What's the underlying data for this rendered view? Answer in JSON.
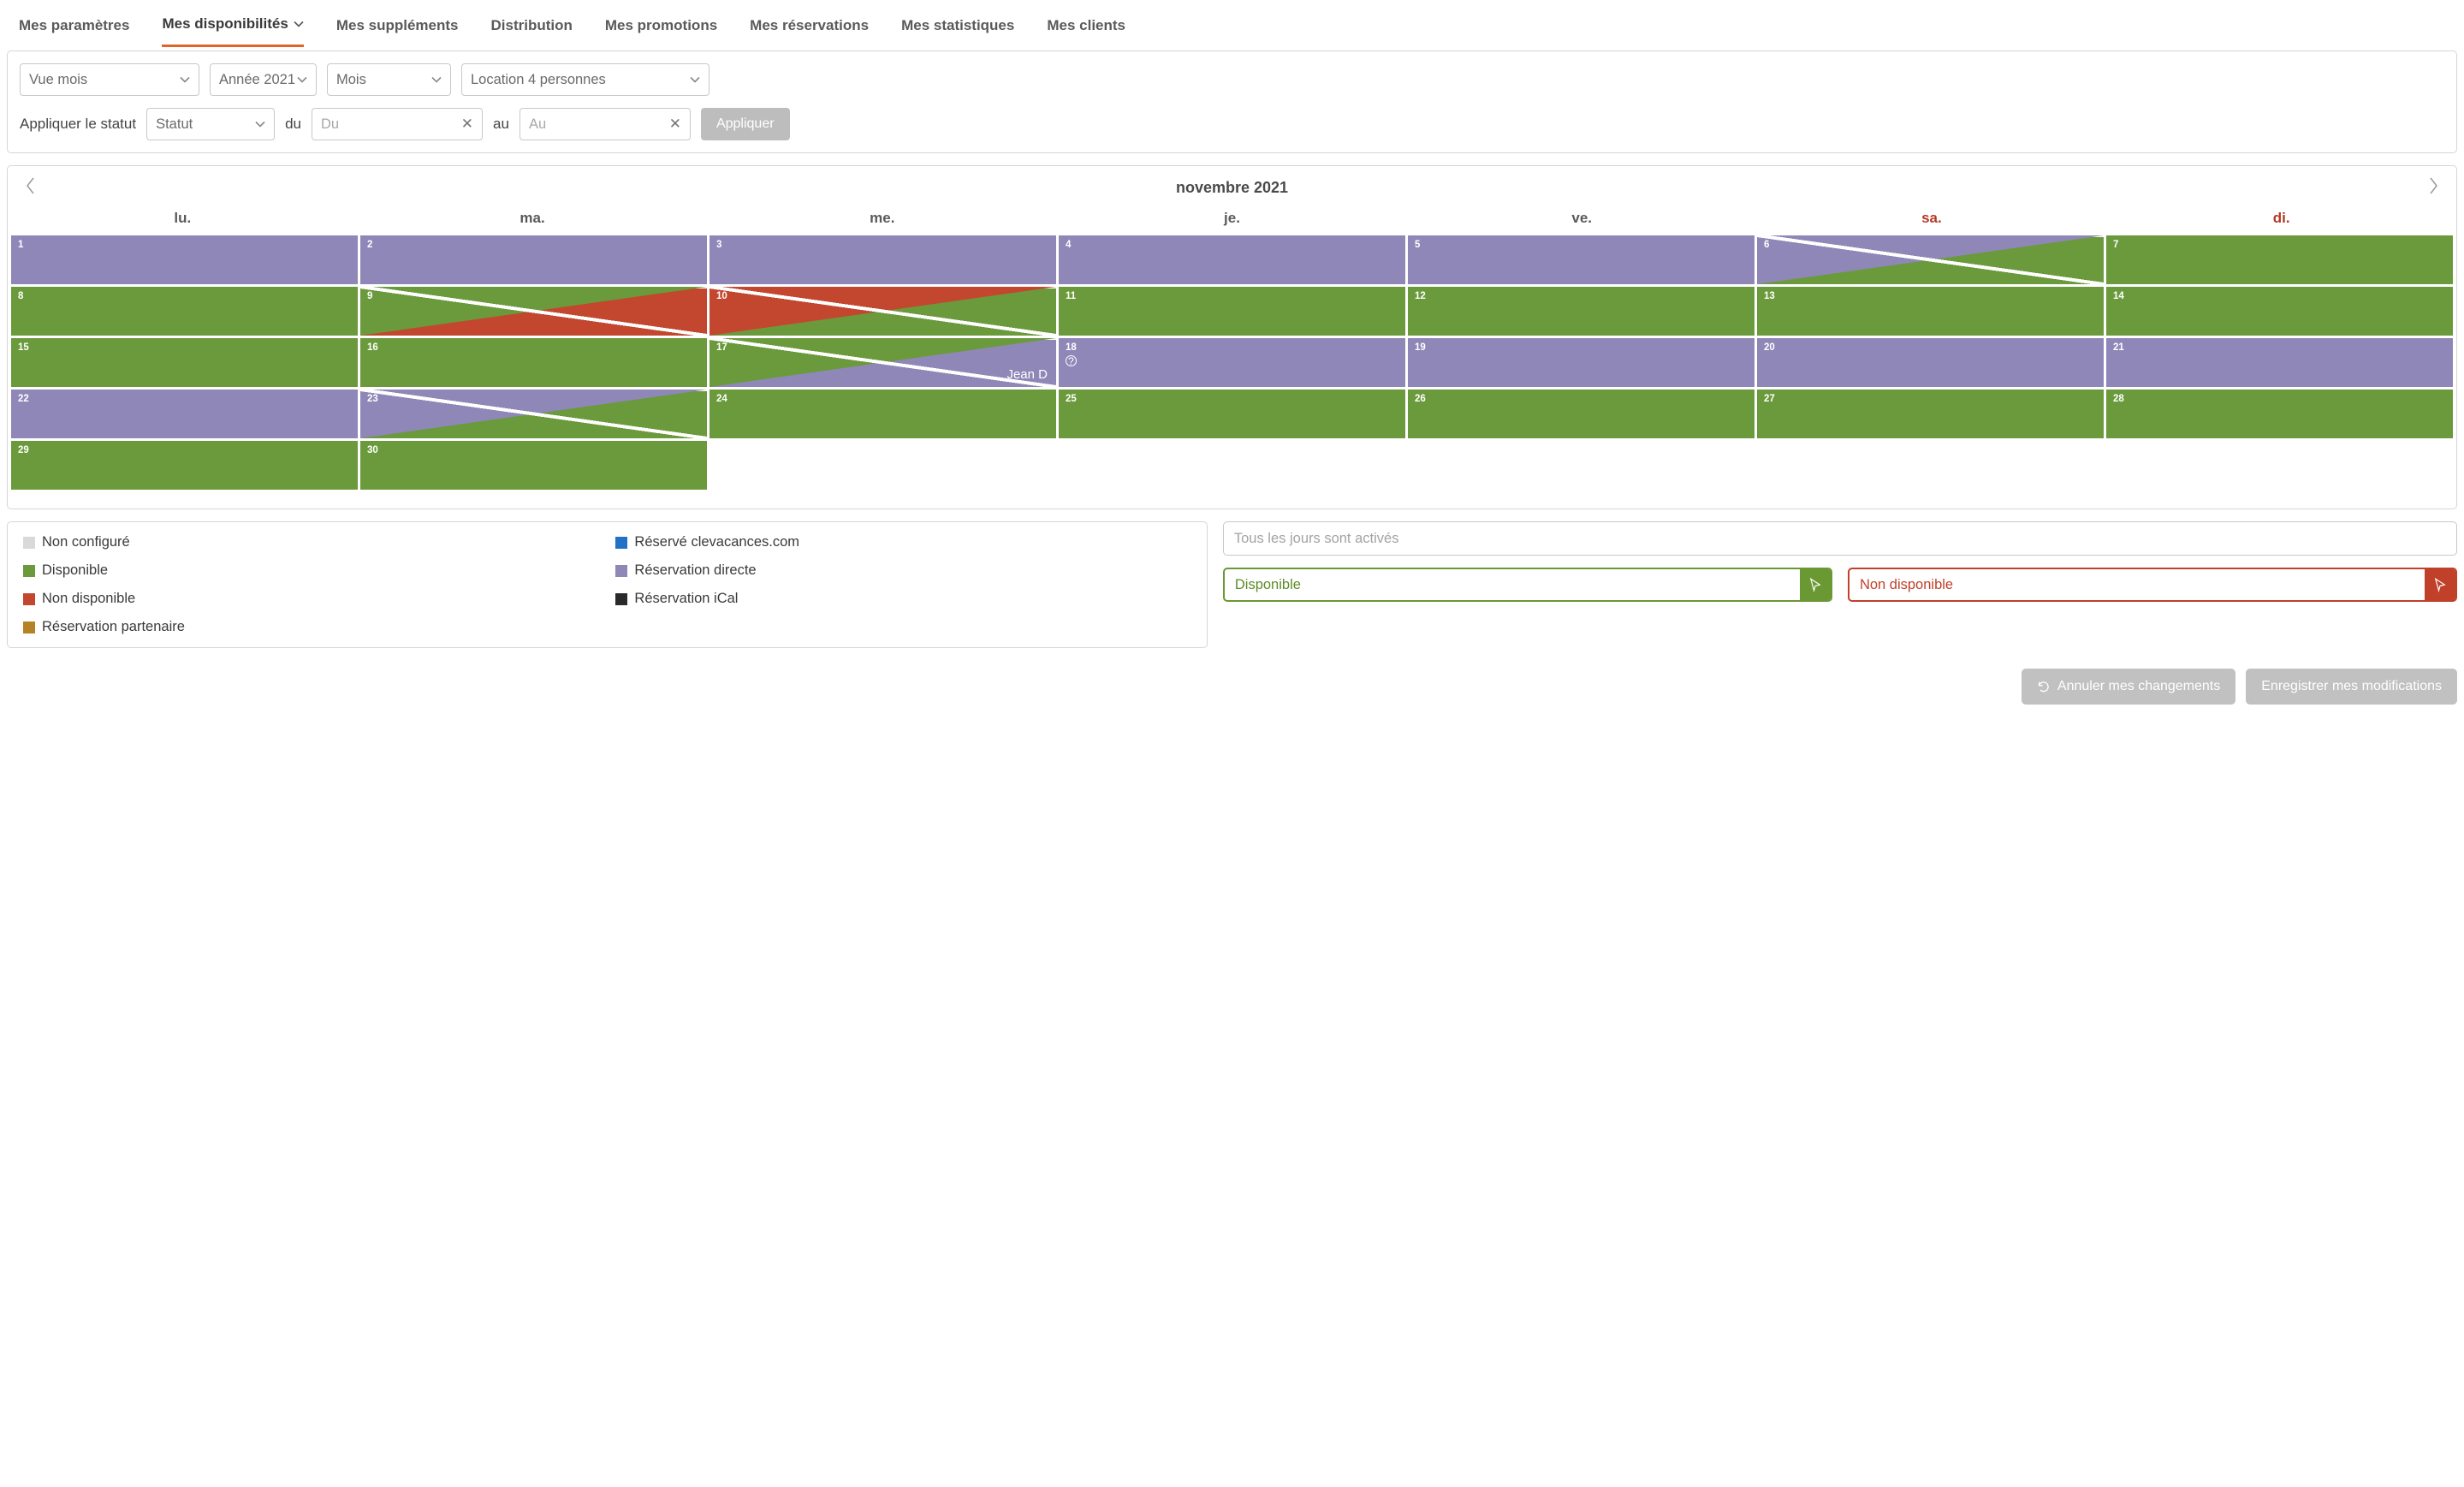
{
  "tabs": {
    "params": "Mes paramètres",
    "dispo": "Mes disponibilités",
    "supp": "Mes suppléments",
    "dist": "Distribution",
    "promo": "Mes promotions",
    "resa": "Mes réservations",
    "stats": "Mes statistiques",
    "clients": "Mes clients"
  },
  "filters": {
    "view": "Vue mois",
    "year": "Année 2021",
    "month": "Mois",
    "location": "Location 4 personnes",
    "apply_status_label": "Appliquer le statut",
    "status_placeholder": "Statut",
    "from_label": "du",
    "from_placeholder": "Du",
    "to_label": "au",
    "to_placeholder": "Au",
    "apply_btn": "Appliquer"
  },
  "calendar": {
    "title": "novembre 2021",
    "dow": [
      "lu.",
      "ma.",
      "me.",
      "je.",
      "ve.",
      "sa.",
      "di."
    ],
    "booking_name": "Jean D",
    "cells": [
      {
        "n": 1,
        "base": "direct"
      },
      {
        "n": 2,
        "base": "direct"
      },
      {
        "n": 3,
        "base": "direct"
      },
      {
        "n": 4,
        "base": "direct"
      },
      {
        "n": 5,
        "base": "direct"
      },
      {
        "n": 6,
        "base": "direct",
        "tri": "avail"
      },
      {
        "n": 7,
        "base": "avail"
      },
      {
        "n": 8,
        "base": "avail"
      },
      {
        "n": 9,
        "base": "avail",
        "tri": "unavail"
      },
      {
        "n": 10,
        "base": "unavail",
        "tri": "avail"
      },
      {
        "n": 11,
        "base": "avail"
      },
      {
        "n": 12,
        "base": "avail"
      },
      {
        "n": 13,
        "base": "avail"
      },
      {
        "n": 14,
        "base": "avail"
      },
      {
        "n": 15,
        "base": "avail"
      },
      {
        "n": 16,
        "base": "avail"
      },
      {
        "n": 17,
        "base": "avail",
        "tri": "direct",
        "label": true
      },
      {
        "n": 18,
        "base": "direct",
        "info": true
      },
      {
        "n": 19,
        "base": "direct"
      },
      {
        "n": 20,
        "base": "direct"
      },
      {
        "n": 21,
        "base": "direct"
      },
      {
        "n": 22,
        "base": "direct"
      },
      {
        "n": 23,
        "base": "direct",
        "tri": "avail"
      },
      {
        "n": 24,
        "base": "avail"
      },
      {
        "n": 25,
        "base": "avail"
      },
      {
        "n": 26,
        "base": "avail"
      },
      {
        "n": 27,
        "base": "avail"
      },
      {
        "n": 28,
        "base": "avail"
      },
      {
        "n": 29,
        "base": "avail"
      },
      {
        "n": 30,
        "base": "avail"
      }
    ]
  },
  "legend": {
    "notconf": "Non configuré",
    "avail": "Disponible",
    "unavail": "Non disponible",
    "partner": "Réservation partenaire",
    "clev": "Réservé clevacances.com",
    "direct": "Réservation directe",
    "ical": "Réservation iCal"
  },
  "actions": {
    "days_placeholder": "Tous les jours sont activés",
    "avail_btn": "Disponible",
    "unavail_btn": "Non disponible"
  },
  "footer": {
    "cancel": "Annuler mes changements",
    "save": "Enregistrer mes modifications"
  },
  "colors": {
    "notconf": "#d9d9d9",
    "avail": "#6b9a3c",
    "unavail": "#c2472e",
    "partner": "#b58326",
    "clev": "#2172c7",
    "direct": "#8f87b8",
    "ical": "#2a2a2a"
  }
}
